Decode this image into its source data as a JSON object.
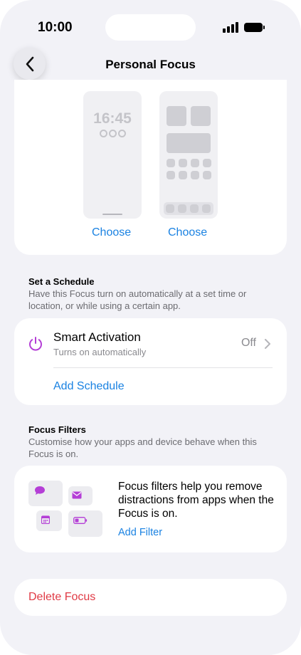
{
  "status_bar": {
    "time": "10:00"
  },
  "nav": {
    "title": "Personal Focus",
    "back_icon": "chevron-left-icon"
  },
  "customize_screens": {
    "lock_screen_preview": {
      "time": "16:45"
    },
    "lock_choose_label": "Choose",
    "home_choose_label": "Choose"
  },
  "schedule_section": {
    "title": "Set a Schedule",
    "description": "Have this Focus turn on automatically at a set time or location, or while using a certain app.",
    "smart_activation": {
      "icon": "power-icon",
      "title": "Smart Activation",
      "subtitle": "Turns on automatically",
      "value": "Off"
    },
    "add_schedule_label": "Add Schedule"
  },
  "filters_section": {
    "title": "Focus Filters",
    "description": "Customise how your apps and device behave when this Focus is on.",
    "card_text": "Focus filters help you remove distractions from apps when the Focus is on.",
    "add_filter_label": "Add Filter",
    "filter_icons": [
      "message-icon",
      "mail-icon",
      "calendar-icon",
      "battery-icon"
    ]
  },
  "delete_label": "Delete Focus",
  "colors": {
    "accent_blue": "#1a82e2",
    "focus_purple": "#b43ed6",
    "destructive_red": "#e03a45",
    "background": "#f2f2f7"
  }
}
